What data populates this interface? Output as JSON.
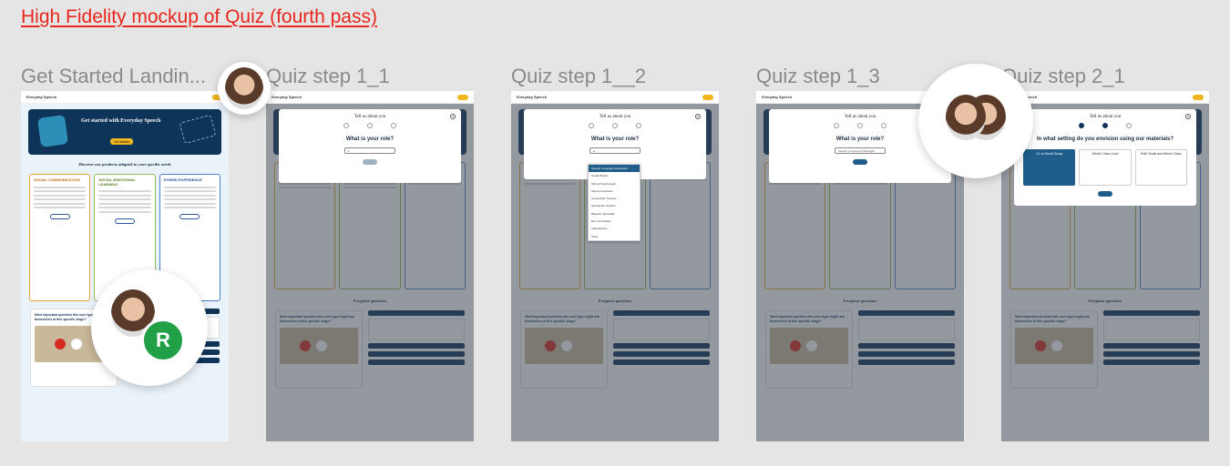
{
  "page_title": "High Fidelity mockup of Quiz (fourth pass)",
  "frames": [
    {
      "label": "Get Started Landin..."
    },
    {
      "label": "Quiz step 1_1"
    },
    {
      "label": "Quiz step 1__2"
    },
    {
      "label": "Quiz step 1_3"
    },
    {
      "label": "Quiz step 2_1"
    }
  ],
  "landing": {
    "logo": "Everyday Speech",
    "hero_title": "Get started with Everyday Speech",
    "hero_button": "Get started",
    "section_title": "Discover our products adapted to your specific needs",
    "cards": [
      "SOCIAL COMMUNICATION",
      "SOCIAL-EMOTIONAL LEARNING",
      "HYBRID EXPERIENCE"
    ],
    "faq_title": "Frequent questions",
    "faq_question": "Most important question this user type might ask themselves at this specific stage?"
  },
  "modal": {
    "title": "Tell us about you",
    "question_role": "What is your role?",
    "question_setting": "In what setting do you envision using our materials?",
    "setting_options": [
      "1:1 or Small Group",
      "Whole Class Level",
      "Both Small and Whole Class"
    ],
    "dropdown_options": [
      "Speech Language Pathologist",
      "Social Worker",
      "School Psychologist",
      "School Counselor",
      "General Ed. Teacher",
      "Special Ed. Teacher",
      "Behavior Specialist",
      "ELL Coordinator",
      "Administrator",
      "Other"
    ]
  },
  "badge_letter": "R"
}
